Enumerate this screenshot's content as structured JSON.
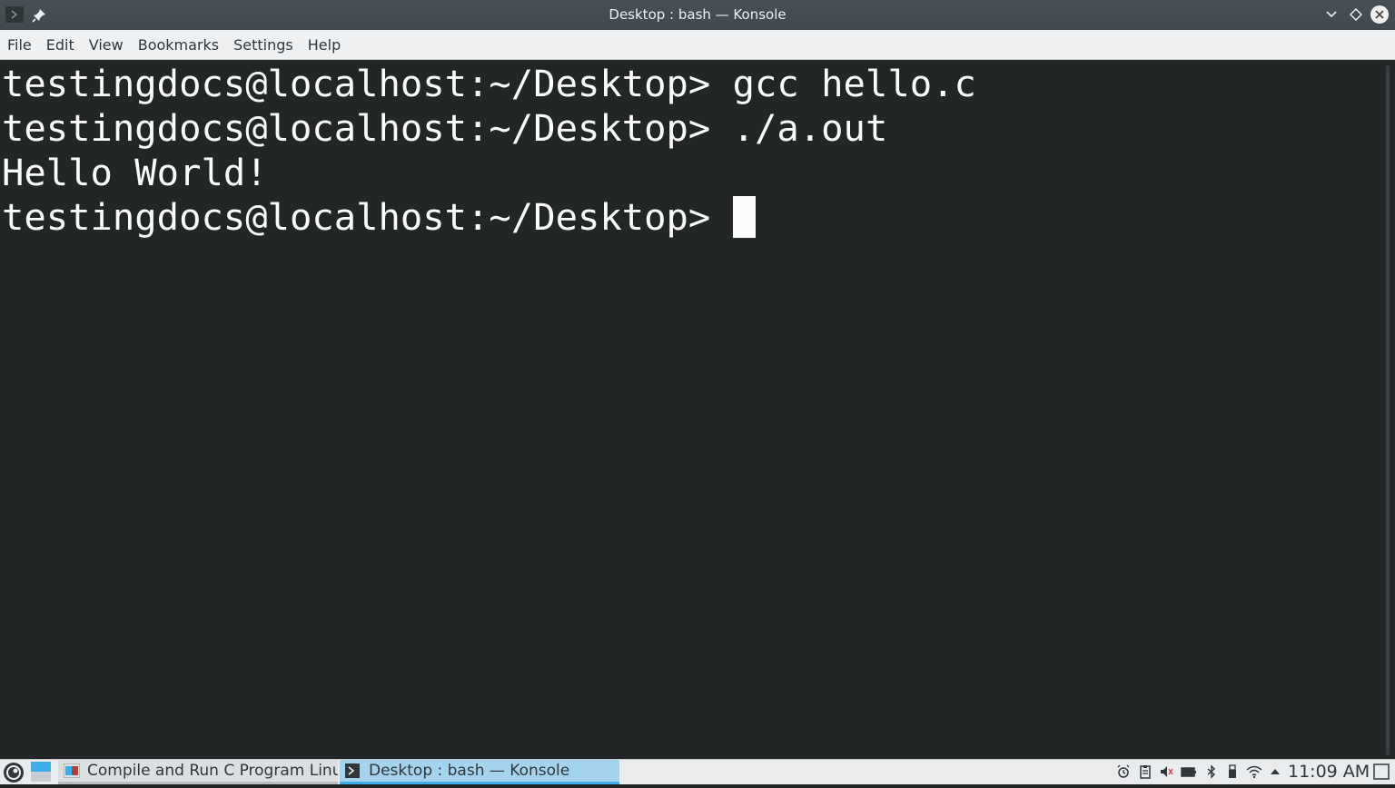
{
  "window": {
    "title": "Desktop : bash — Konsole"
  },
  "menu": [
    "File",
    "Edit",
    "View",
    "Bookmarks",
    "Settings",
    "Help"
  ],
  "terminal": {
    "lines": [
      "testingdocs@localhost:~/Desktop> gcc hello.c",
      "testingdocs@localhost:~/Desktop> ./a.out",
      "Hello World!",
      "testingdocs@localhost:~/Desktop> "
    ],
    "colors": {
      "background": "#232627",
      "foreground": "#fcfcfc"
    }
  },
  "taskbar": {
    "tasks": [
      {
        "label": "Compile and Run C Program Linu...",
        "icon": "browser-icon"
      },
      {
        "label": "Desktop : bash — Konsole",
        "icon": "konsole-icon",
        "active": true
      }
    ],
    "tray_icons": [
      "alarm-icon",
      "clipboard-icon",
      "volume-muted-icon",
      "battery-icon",
      "bluetooth-icon",
      "usb-icon",
      "wifi-icon",
      "expand-tray-icon"
    ],
    "clock": "11:09 AM",
    "accent": "#3daee9"
  }
}
